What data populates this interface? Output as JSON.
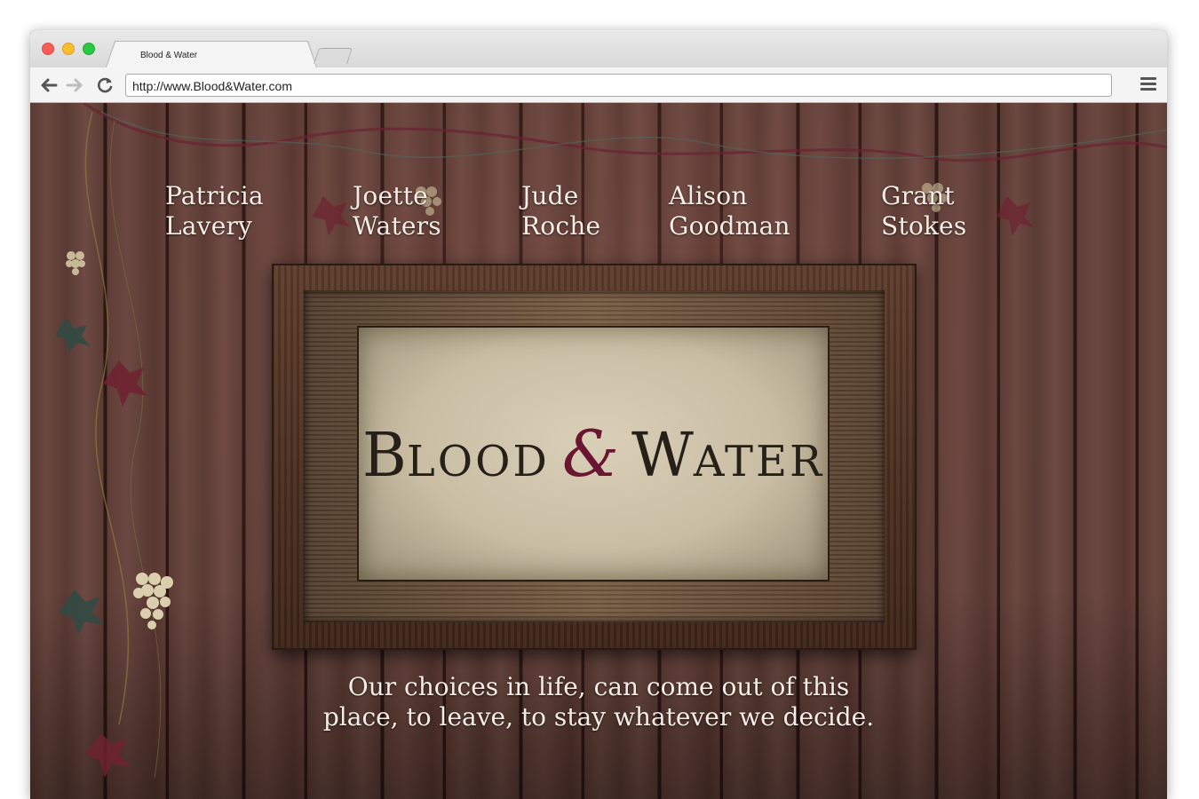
{
  "browser": {
    "tab_title": "Blood & Water",
    "url": "http://www.Blood&Water.com"
  },
  "nav": {
    "items": [
      {
        "first": "Patricia",
        "last": "Lavery"
      },
      {
        "first": "Joette",
        "last": "Waters"
      },
      {
        "first": "Jude",
        "last": "Roche"
      },
      {
        "first": "Alison",
        "last": "Goodman"
      },
      {
        "first": "Grant",
        "last": "Stokes"
      }
    ]
  },
  "logo": {
    "word1_initial": "B",
    "word1_rest": "LOOD",
    "ampersand": "&",
    "word2_initial": "W",
    "word2_rest": "ATER",
    "ampersand_color": "#6a1531"
  },
  "tagline": {
    "line1": "Our choices in life, can come out of this",
    "line2": "place, to leave, to stay whatever we decide."
  },
  "icons": [
    "back-arrow-icon",
    "forward-arrow-icon",
    "reload-icon",
    "menu-icon"
  ]
}
